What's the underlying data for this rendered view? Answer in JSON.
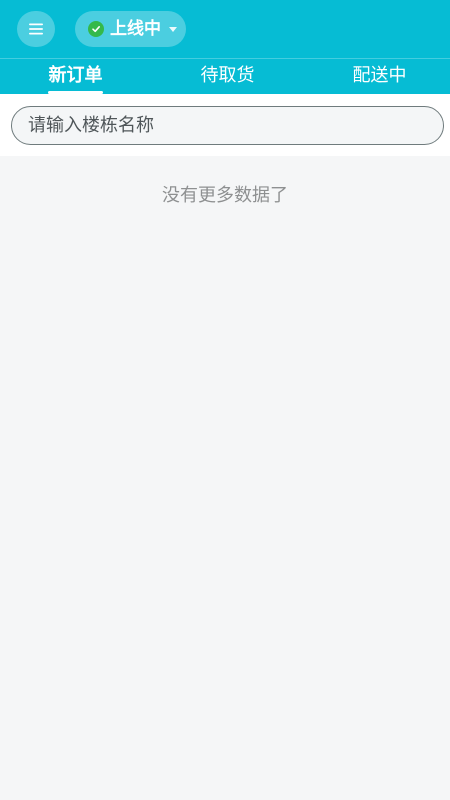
{
  "header": {
    "menu_icon": "hamburger-menu-icon",
    "status": {
      "label": "上线中",
      "icon": "check-circle-icon",
      "dropdown_icon": "caret-down-icon",
      "color": "#34b94a"
    }
  },
  "tabs": [
    {
      "label": "新订单",
      "active": true
    },
    {
      "label": "待取货",
      "active": false
    },
    {
      "label": "配送中",
      "active": false
    }
  ],
  "search": {
    "placeholder": "请输入楼栋名称",
    "value": ""
  },
  "list": {
    "empty_message": "没有更多数据了"
  },
  "colors": {
    "accent": "#06bcd4",
    "background": "#f5f6f7"
  }
}
